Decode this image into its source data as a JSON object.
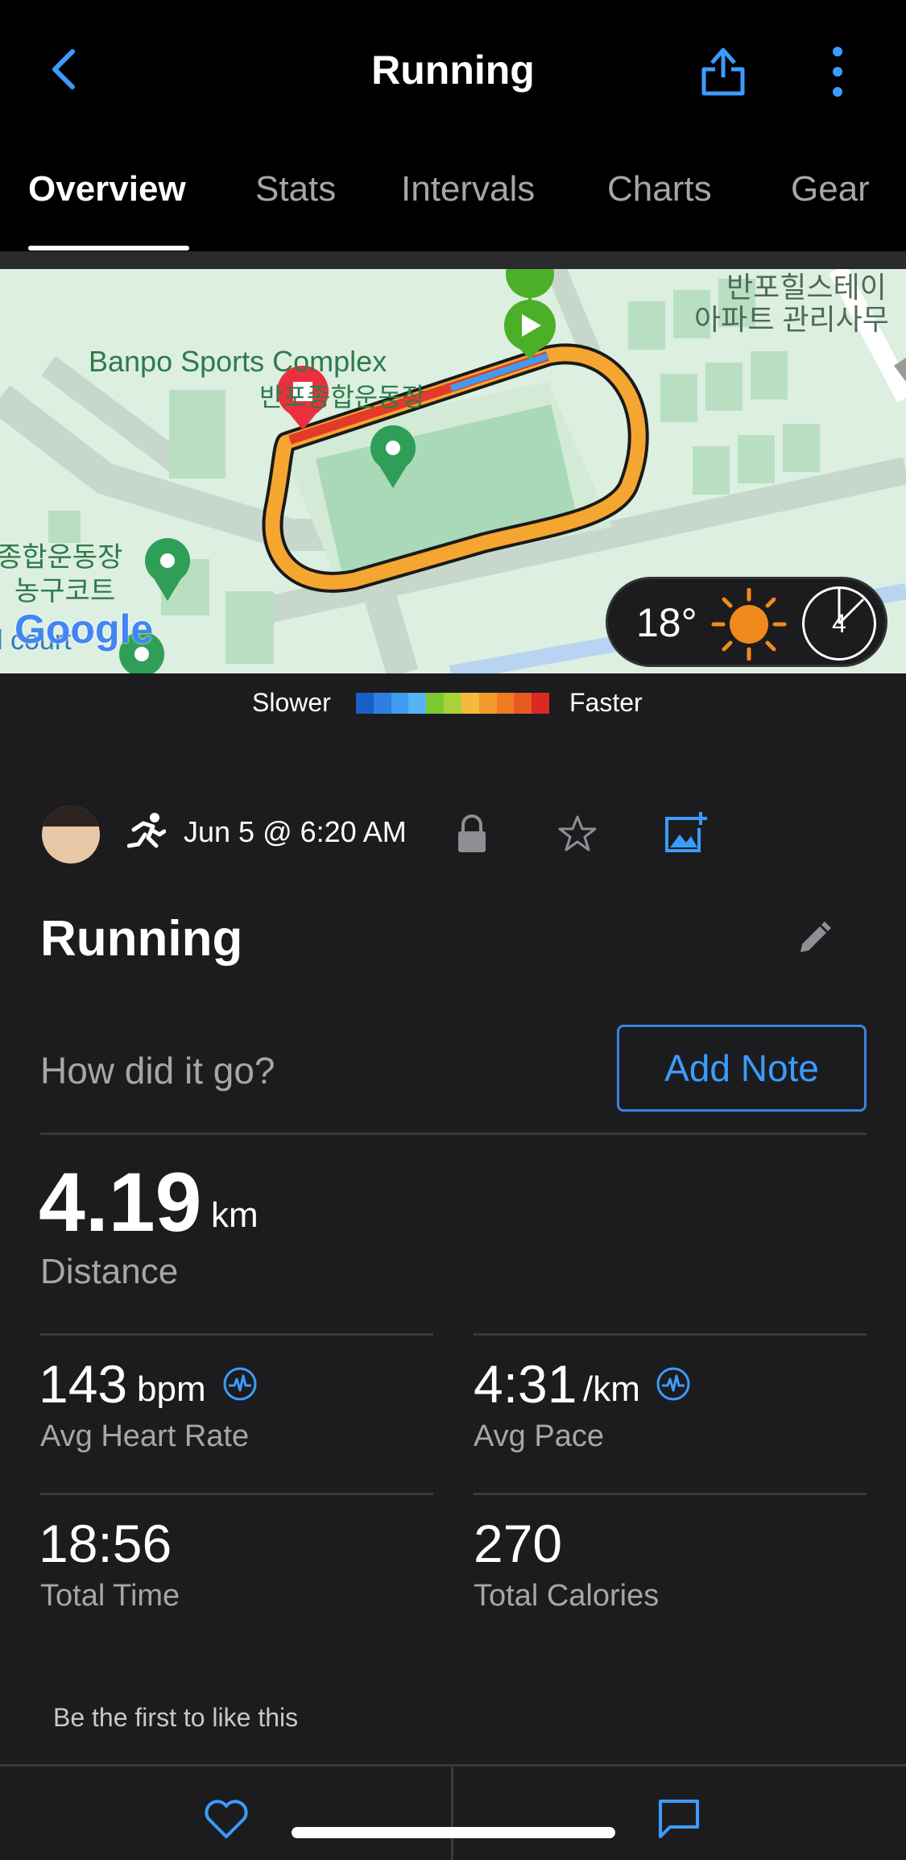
{
  "header": {
    "title": "Running"
  },
  "tabs": [
    {
      "label": "Overview",
      "active": true
    },
    {
      "label": "Stats"
    },
    {
      "label": "Intervals"
    },
    {
      "label": "Charts"
    },
    {
      "label": "Gear"
    }
  ],
  "map": {
    "labels": {
      "complex_en": "Banpo Sports Complex",
      "complex_kr": "반포종합운동장",
      "apt1": "반포힐스테이",
      "apt2": "아파트 관리사무",
      "left1": "종합운동장",
      "left2": "농구코트",
      "left3": "l court",
      "google": "Google"
    },
    "weather": {
      "temperature": "18°",
      "wind": "4"
    }
  },
  "legend": {
    "slower": "Slower",
    "faster": "Faster",
    "colors": [
      "#1a5fc9",
      "#2f7fe3",
      "#3f9cf0",
      "#56b4f5",
      "#7cc832",
      "#a9d13a",
      "#f5b93c",
      "#f29a2c",
      "#ef7a22",
      "#e55b1f",
      "#d92a25"
    ]
  },
  "activity": {
    "date": "Jun 5 @ 6:20 AM",
    "title": "Running",
    "note_prompt": "How did it go?",
    "add_note": "Add Note"
  },
  "stats": {
    "distance": {
      "value": "4.19",
      "unit": "km",
      "label": "Distance"
    },
    "heart_rate": {
      "value": "143",
      "unit": "bpm",
      "label": "Avg Heart Rate"
    },
    "pace": {
      "value": "4:31",
      "unit": "/km",
      "label": "Avg Pace"
    },
    "time": {
      "value": "18:56",
      "label": "Total Time"
    },
    "calories": {
      "value": "270",
      "label": "Total Calories"
    }
  },
  "likes": {
    "text": "Be the first to like this"
  },
  "colors": {
    "accent": "#3b9cff",
    "background": "#1c1c1e"
  }
}
